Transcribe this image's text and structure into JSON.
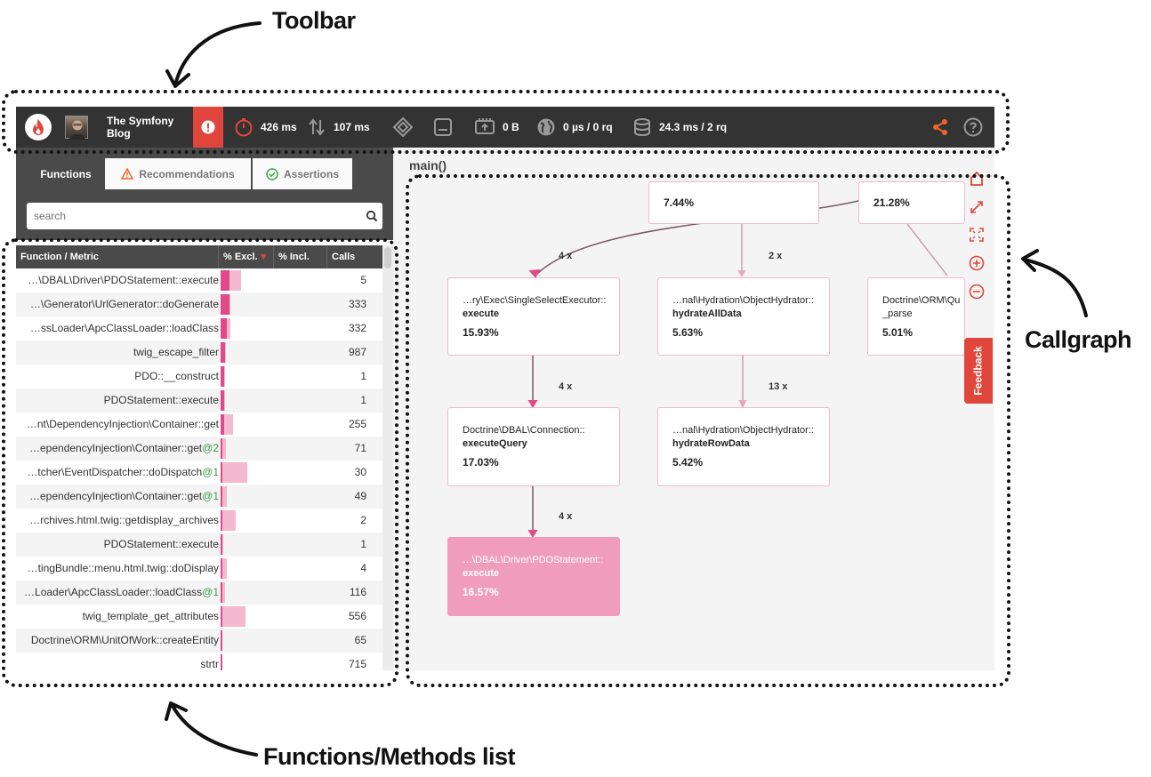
{
  "annotations": {
    "toolbar": "Toolbar",
    "callgraph": "Callgraph",
    "functions_list": "Functions/Methods list"
  },
  "toolbar": {
    "project_name": "The Symfony Blog",
    "wall_time": "426 ms",
    "io_wait": "107 ms",
    "network": "0 B",
    "http": "0 µs / 0 rq",
    "sql": "24.3 ms / 2 rq",
    "accent_color": "#e0463c",
    "share_color": "#f0652a"
  },
  "tabs": [
    {
      "label": "Functions",
      "icon": null
    },
    {
      "label": "Recommendations",
      "icon": "warning-icon"
    },
    {
      "label": "Assertions",
      "icon": "check-circle-icon"
    }
  ],
  "search": {
    "placeholder": "search"
  },
  "table": {
    "columns": [
      "Function / Metric",
      "% Excl.",
      "% Incl.",
      "Calls"
    ],
    "rows": [
      {
        "name": "…\\DBAL\\Driver\\PDOStatement::execute",
        "suffix": "",
        "excl": 0.41,
        "incl": 0.95,
        "calls": "5"
      },
      {
        "name": "…\\Generator\\UrlGenerator::doGenerate",
        "suffix": "",
        "excl": 0.42,
        "incl": 0.45,
        "calls": "333"
      },
      {
        "name": "…ssLoader\\ApcClassLoader::loadClass",
        "suffix": "",
        "excl": 0.3,
        "incl": 0.45,
        "calls": "332"
      },
      {
        "name": "twig_escape_filter",
        "suffix": "",
        "excl": 0.2,
        "incl": 0.25,
        "calls": "987"
      },
      {
        "name": "PDO::__construct",
        "suffix": "",
        "excl": 0.18,
        "incl": 0.22,
        "calls": "1"
      },
      {
        "name": "PDOStatement::execute",
        "suffix": "",
        "excl": 0.18,
        "incl": 0.22,
        "calls": "1"
      },
      {
        "name": "…nt\\DependencyInjection\\Container::get",
        "suffix": "",
        "excl": 0.15,
        "incl": 0.6,
        "calls": "255"
      },
      {
        "name": "…ependencyInjection\\Container::get",
        "suffix": "@2",
        "excl": 0.1,
        "incl": 0.25,
        "calls": "71"
      },
      {
        "name": "…tcher\\EventDispatcher::doDispatch",
        "suffix": "@1",
        "excl": 0.1,
        "incl": 1.25,
        "calls": "30"
      },
      {
        "name": "…ependencyInjection\\Container::get",
        "suffix": "@1",
        "excl": 0.1,
        "incl": 0.3,
        "calls": "49"
      },
      {
        "name": "…rchives.html.twig::getdisplay_archives",
        "suffix": "",
        "excl": 0.1,
        "incl": 0.7,
        "calls": "2"
      },
      {
        "name": "PDOStatement::execute",
        "suffix": "",
        "excl": 0.1,
        "incl": 0.12,
        "calls": "1"
      },
      {
        "name": "…tingBundle::menu.html.twig::doDisplay",
        "suffix": "",
        "excl": 0.1,
        "incl": 0.3,
        "calls": "4"
      },
      {
        "name": "…Loader\\ApcClassLoader::loadClass",
        "suffix": "@1",
        "excl": 0.1,
        "incl": 0.2,
        "calls": "116"
      },
      {
        "name": "twig_template_get_attributes",
        "suffix": "",
        "excl": 0.1,
        "incl": 1.15,
        "calls": "556"
      },
      {
        "name": "Doctrine\\ORM\\UnitOfWork::createEntity",
        "suffix": "",
        "excl": 0.08,
        "incl": 0.1,
        "calls": "65"
      },
      {
        "name": "strtr",
        "suffix": "",
        "excl": 0.08,
        "incl": 0.1,
        "calls": "715"
      }
    ]
  },
  "callgraph": {
    "root": "main()",
    "nodes": [
      {
        "id": "n_top1",
        "ns": "",
        "method": "",
        "pct": "7.44%"
      },
      {
        "id": "n_top2",
        "ns": "",
        "method": "",
        "pct": "21.28%"
      },
      {
        "id": "n_select",
        "ns": "…ry\\Exec\\SingleSelectExecutor::",
        "method": "execute",
        "pct": "15.93%"
      },
      {
        "id": "n_hydrate_all",
        "ns": "…nal\\Hydration\\ObjectHydrator::",
        "method": "hydrateAllData",
        "pct": "5.63%"
      },
      {
        "id": "n_parse",
        "ns": "Doctrine\\ORM\\Qu",
        "method": "_parse",
        "pct": "5.01%"
      },
      {
        "id": "n_execquery",
        "ns": "Doctrine\\DBAL\\Connection::",
        "method": "executeQuery",
        "pct": "17.03%"
      },
      {
        "id": "n_hydrate_row",
        "ns": "…nal\\Hydration\\ObjectHydrator::",
        "method": "hydrateRowData",
        "pct": "5.42%"
      },
      {
        "id": "n_pdo",
        "ns": "…\\DBAL\\Driver\\PDOStatement::",
        "method": "execute",
        "pct": "16.57%"
      }
    ],
    "edges": [
      {
        "label": "4 x"
      },
      {
        "label": "2 x"
      },
      {
        "label": "4 x"
      },
      {
        "label": "13 x"
      },
      {
        "label": "4 x"
      }
    ],
    "feedback": "Feedback"
  }
}
